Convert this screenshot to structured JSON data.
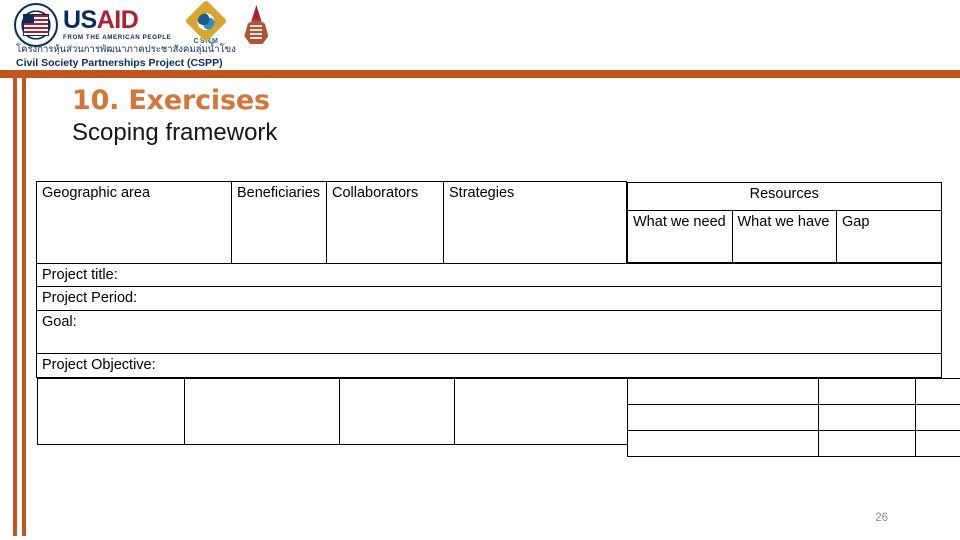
{
  "branding": {
    "usaid_name_part1": "US",
    "usaid_name_part2": "AID",
    "usaid_tagline": "FROM THE AMERICAN PEOPLE",
    "csnm_label": "CSNM",
    "thai_line": "โครงการหุ้นส่วนการพัฒนาภาคประชาสังคมลุ่มน้ำโขง",
    "english_line": "Civil Society Partnerships Project (CSPP)",
    "accent_color": "#C0561E",
    "usaid_blue": "#0A2B5E",
    "usaid_red": "#B01F2E"
  },
  "slide": {
    "title": "10. Exercises",
    "subtitle": "Scoping framework",
    "title_color": "#D4763A",
    "page_number": "26"
  },
  "table": {
    "headers": {
      "geographic_area": "Geographic area",
      "beneficiaries": "Beneficiaries",
      "collaborators": "Collaborators",
      "strategies": "Strategies",
      "resources": "Resources",
      "what_we_need": "What we need",
      "what_we_have": "What we have",
      "gap": "Gap"
    },
    "rows": {
      "project_title": "Project title:",
      "project_period": "Project Period:",
      "goal": "Goal:",
      "project_objective": "Project Objective:"
    },
    "body_cells": {
      "left": [
        "",
        "",
        "",
        ""
      ],
      "resources": [
        [
          "",
          "",
          ""
        ],
        [
          "",
          "",
          ""
        ],
        [
          "",
          "",
          ""
        ]
      ]
    }
  }
}
